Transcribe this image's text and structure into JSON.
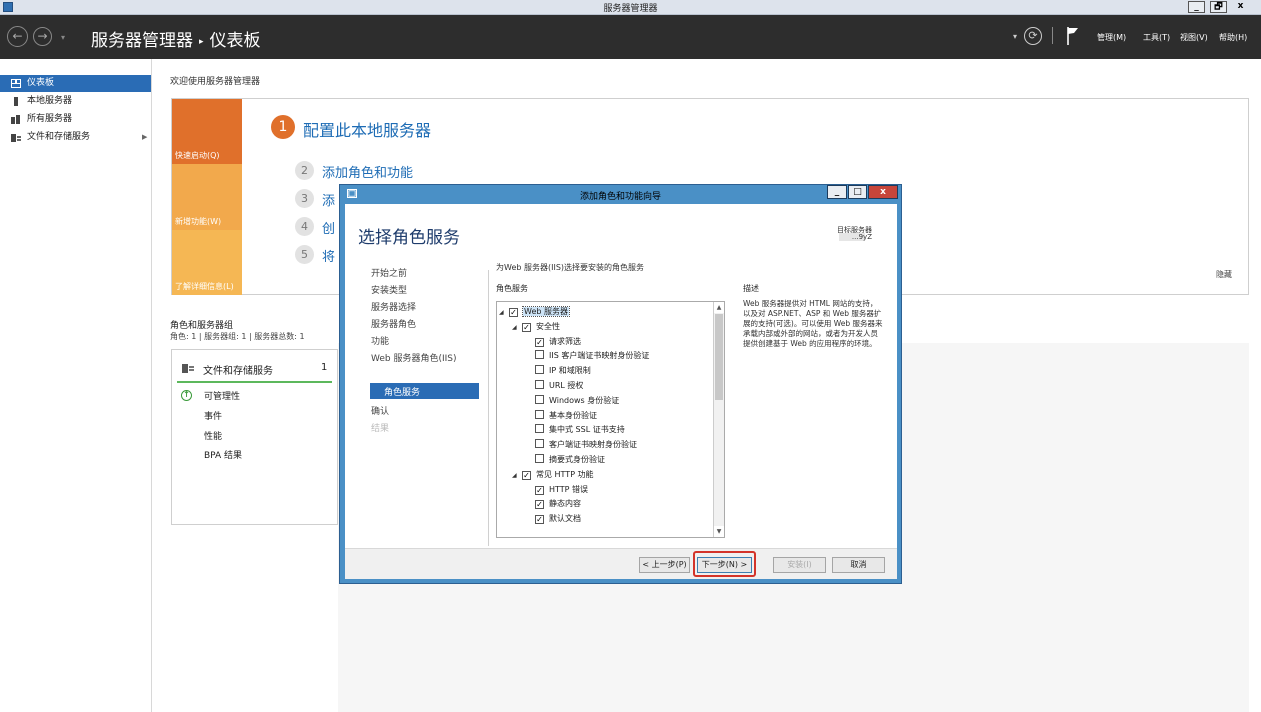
{
  "window": {
    "title": "服务器管理器",
    "minimize": "_",
    "restore": "🗗",
    "close": "x"
  },
  "header": {
    "breadcrumb_app": "服务器管理器",
    "breadcrumb_sep": "▸",
    "breadcrumb_page": "仪表板",
    "menus": [
      "管理(M)",
      "工具(T)",
      "视图(V)",
      "帮助(H)"
    ]
  },
  "sidebar": {
    "items": [
      {
        "label": "仪表板",
        "icon": "dashboard-icon"
      },
      {
        "label": "本地服务器",
        "icon": "server-icon"
      },
      {
        "label": "所有服务器",
        "icon": "servers-icon"
      },
      {
        "label": "文件和存储服务",
        "icon": "storage-icon"
      }
    ]
  },
  "main": {
    "welcome": "欢迎使用服务器管理器",
    "tiles": [
      "快速启动(Q)",
      "新增功能(W)",
      "了解详细信息(L)"
    ],
    "step1": {
      "num": "1",
      "label": "配置此本地服务器"
    },
    "steps": [
      {
        "num": "2",
        "label": "添加角色和功能"
      },
      {
        "num": "3",
        "label": "添"
      },
      {
        "num": "4",
        "label": "创"
      },
      {
        "num": "5",
        "label": "将"
      }
    ],
    "hide": "隐藏",
    "roles_heading": "角色和服务器组",
    "roles_counts": "角色: 1 | 服务器组: 1 | 服务器总数: 1",
    "server_tile": {
      "title": "文件和存储服务",
      "count": "1",
      "rows": [
        "可管理性",
        "事件",
        "性能",
        "BPA 结果"
      ]
    }
  },
  "wizard": {
    "title": "添加角色和功能向导",
    "heading": "选择角色服务",
    "target_label": "目标服务器",
    "target_value": "...9yZ",
    "nav": [
      "开始之前",
      "安装类型",
      "服务器选择",
      "服务器角色",
      "功能",
      "Web 服务器角色(IIS)",
      "角色服务",
      "确认",
      "结果"
    ],
    "description_intro": "为Web 服务器(IIS)选择要安装的角色服务",
    "role_services_label": "角色服务",
    "describe_label": "描述",
    "describe_text": "Web 服务器提供对 HTML 网站的支持，以及对 ASP.NET、ASP 和 Web 服务器扩展的支持(可选)。可以使用 Web 服务器来承载内部或外部的网站，或者为开发人员提供创建基于 Web 的应用程序的环境。",
    "tree": [
      {
        "label": "Web 服务器",
        "level": 0,
        "expand": "◢",
        "checked": true,
        "selected": true
      },
      {
        "label": "安全性",
        "level": 1,
        "expand": "◢",
        "checked": true
      },
      {
        "label": "请求筛选",
        "level": 2,
        "checked": true
      },
      {
        "label": "IIS 客户端证书映射身份验证",
        "level": 2,
        "checked": false
      },
      {
        "label": "IP 和域限制",
        "level": 2,
        "checked": false
      },
      {
        "label": "URL 授权",
        "level": 2,
        "checked": false
      },
      {
        "label": "Windows 身份验证",
        "level": 2,
        "checked": false
      },
      {
        "label": "基本身份验证",
        "level": 2,
        "checked": false
      },
      {
        "label": "集中式 SSL 证书支持",
        "level": 2,
        "checked": false
      },
      {
        "label": "客户端证书映射身份验证",
        "level": 2,
        "checked": false
      },
      {
        "label": "摘要式身份验证",
        "level": 2,
        "checked": false
      },
      {
        "label": "常见 HTTP 功能",
        "level": 1,
        "expand": "◢",
        "checked": true
      },
      {
        "label": "HTTP 错误",
        "level": 2,
        "checked": true
      },
      {
        "label": "静态内容",
        "level": 2,
        "checked": true
      },
      {
        "label": "默认文档",
        "level": 2,
        "checked": true
      }
    ],
    "buttons": {
      "prev": "< 上一步(P)",
      "next": "下一步(N) >",
      "install": "安装(I)",
      "cancel": "取消"
    }
  }
}
